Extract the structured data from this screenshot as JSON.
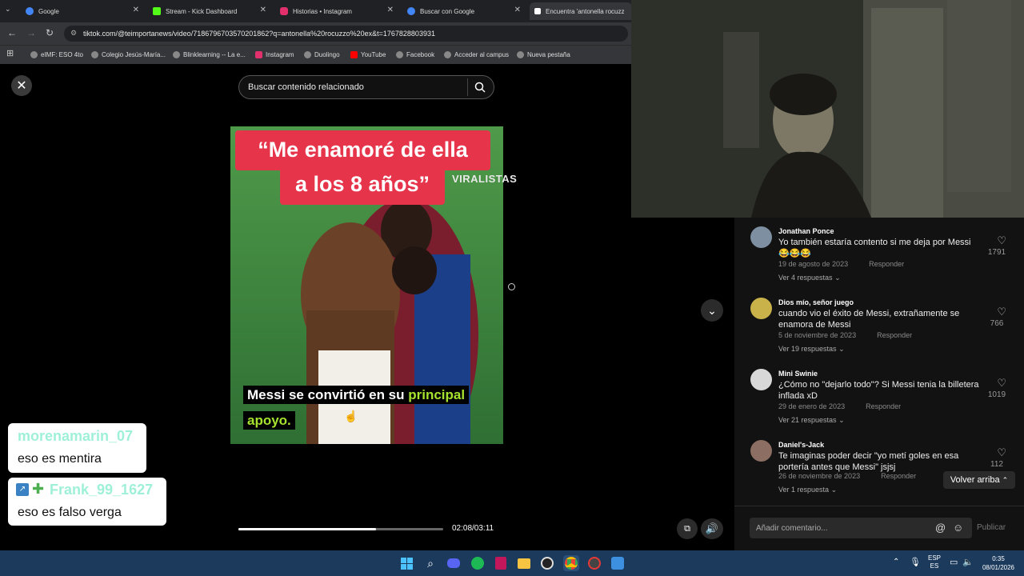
{
  "browser": {
    "tabs": [
      {
        "title": "Google",
        "color": "#4285f4"
      },
      {
        "title": "Stream - Kick Dashboard",
        "color": "#53fc18"
      },
      {
        "title": "Historias • Instagram",
        "color": "#e1306c"
      },
      {
        "title": "Buscar con Google",
        "color": "#4285f4"
      },
      {
        "title": "Encuentra 'antonella rocuzz",
        "color": "#ffffff"
      }
    ],
    "url": "tiktok.com/@teimportanews/video/7186796703570201862?q=antonella%20rocuzzo%20ex&t=1767828803931",
    "bookmarks": [
      "eIMF: ESO 4to",
      "Colegio Jesús-María...",
      "Blinklearning -- La e...",
      "Instagram",
      "Duolingo",
      "YouTube",
      "Facebook",
      "Acceder al campus",
      "Nueva pestaña"
    ]
  },
  "tiktok": {
    "search_placeholder": "Buscar contenido relacionado",
    "video": {
      "title_line1": "“Me enamoré de ella",
      "title_line2": "a los 8 años”",
      "watermark": "VIRALISTAS",
      "subtitle_part1": "Messi se convirtió en su",
      "subtitle_highlight": "principal",
      "subtitle_part2": "apoyo.",
      "time": "02:08/03:11",
      "progress": 0.67
    },
    "comments": [
      {
        "name": "Jonathan Ponce",
        "text": "Yo también estaría contento si me deja por Messi 😂😂😂",
        "date": "19 de agosto de 2023",
        "reply": "Responder",
        "more": "Ver 4 respuestas",
        "likes": "1791"
      },
      {
        "name": "Dios mío, señor juego",
        "text": "cuando vio el éxito de Messi, extrañamente se enamora de Messi",
        "date": "5 de noviembre de 2023",
        "reply": "Responder",
        "more": "Ver 19 respuestas",
        "likes": "766"
      },
      {
        "name": "Mini Swinie",
        "text": "¿Cómo no \"dejarlo todo\"? Si Messi tenia la billetera inflada xD",
        "date": "29 de enero de 2023",
        "reply": "Responder",
        "more": "Ver 21 respuestas",
        "likes": "1019"
      },
      {
        "name": "Daniel's-Jack",
        "text": "Te imaginas poder decir \"yo metí goles en esa portería antes que Messi\" jsjsj",
        "date": "26 de noviembre de 2023",
        "reply": "Responder",
        "more": "Ver 1 respuesta",
        "likes": "112"
      }
    ],
    "back_to_top": "Volver arriba",
    "comment_placeholder": "Añadir comentario...",
    "publish": "Publicar"
  },
  "chat": [
    {
      "user": "morenamarin_07",
      "message": "eso es mentira"
    },
    {
      "user": "Frank_99_1627",
      "message": "eso es falso verga"
    }
  ],
  "taskbar": {
    "lang_top": "ESP",
    "lang_bottom": "ES",
    "time": "0:35",
    "date": "08/01/2026"
  }
}
